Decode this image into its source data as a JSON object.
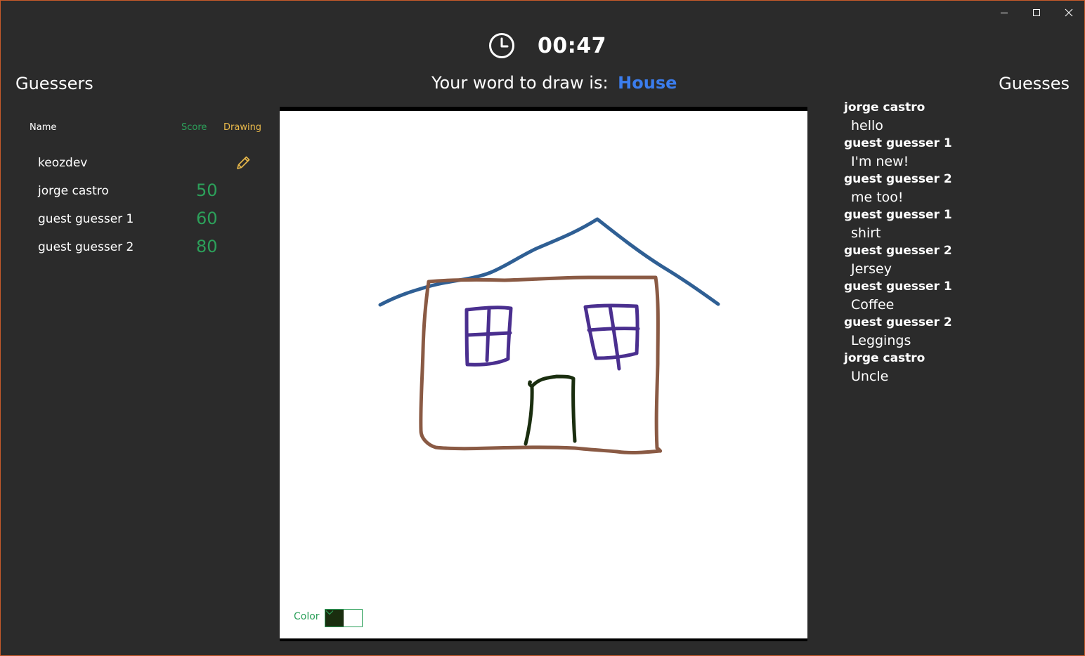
{
  "window": {
    "controls": {
      "minimize_icon": "minimize-icon",
      "maximize_icon": "maximize-icon",
      "close_icon": "close-icon"
    }
  },
  "timer": {
    "icon": "clock-icon",
    "value": "00:47"
  },
  "prompt": {
    "label": "Your word to draw is:",
    "word": "House",
    "word_color": "#3b7ded"
  },
  "guessers_panel": {
    "title": "Guessers",
    "columns": {
      "name": "Name",
      "score": "Score",
      "drawing": "Drawing"
    },
    "players": [
      {
        "name": "keozdev",
        "score": "",
        "is_drawing": true
      },
      {
        "name": "jorge castro",
        "score": "50",
        "is_drawing": false
      },
      {
        "name": "guest guesser 1",
        "score": "60",
        "is_drawing": false
      },
      {
        "name": "guest guesser 2",
        "score": "80",
        "is_drawing": false
      }
    ],
    "score_color": "#2ca05a",
    "drawing_color": "#e8b84a"
  },
  "canvas": {
    "color_label": "Color",
    "selected_color": "#1a2e0f",
    "stroke_colors": {
      "roof": "#2f5f94",
      "walls": "#8a5a44",
      "windows": "#4a2f8f",
      "door": "#1a2e0f"
    }
  },
  "guesses_panel": {
    "title": "Guesses",
    "items": [
      {
        "user": "jorge castro",
        "text": "hello"
      },
      {
        "user": "guest guesser 1",
        "text": "I'm new!"
      },
      {
        "user": "guest guesser 2",
        "text": "me too!"
      },
      {
        "user": "guest guesser 1",
        "text": "shirt"
      },
      {
        "user": "guest guesser 2",
        "text": "Jersey"
      },
      {
        "user": "guest guesser 1",
        "text": "Coffee"
      },
      {
        "user": "guest guesser 2",
        "text": "Leggings"
      },
      {
        "user": "jorge castro",
        "text": "Uncle"
      }
    ]
  }
}
